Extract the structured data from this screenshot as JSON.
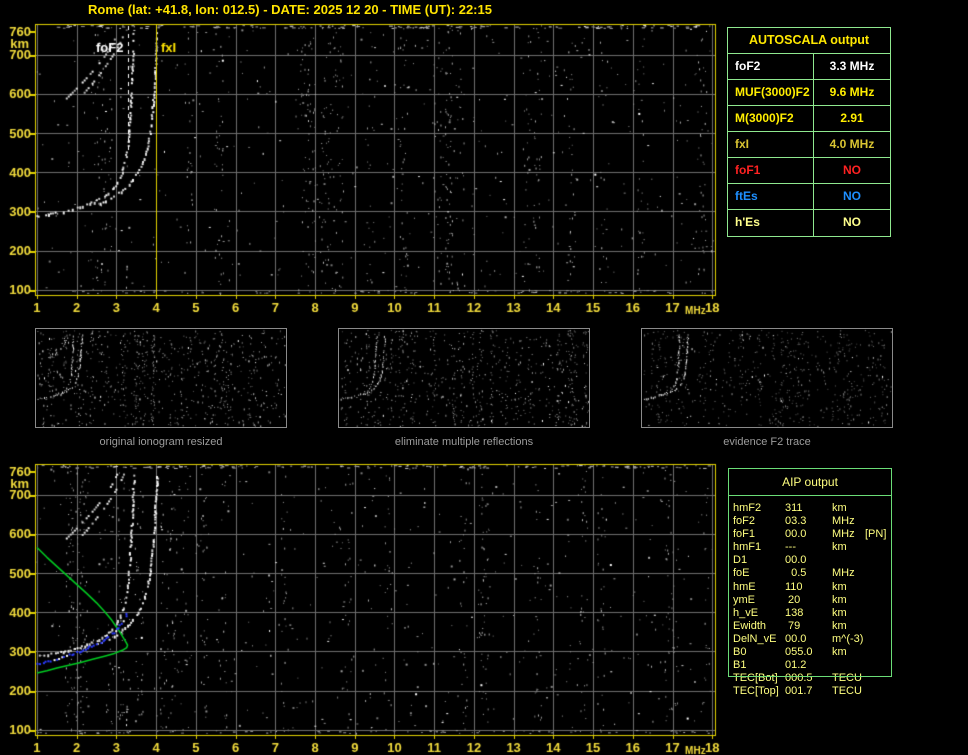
{
  "title": "Rome (lat: +41.8, lon: 012.5) - DATE: 2025 12 20 - TIME (UT): 22:15",
  "colors": {
    "background": "#000000",
    "plot_border": "#E3D300",
    "grid": "#6F6F6F",
    "axis_text": "#F2DC3C",
    "autoscala_border": "#8FE88F",
    "aip_border": "#6ADD77",
    "aip_text": "#FFFF80",
    "caption_text": "#9C9C9C",
    "trace_white": "#FFFFFF",
    "profile_green": "#00CE22",
    "fitted_blue": "#2B3BFF"
  },
  "autoscala": {
    "header": "AUTOSCALA output",
    "rows": [
      {
        "label": "foF2",
        "value": "3.3 MHz",
        "color": "#FFFFFF"
      },
      {
        "label": "MUF(3000)F2",
        "value": "9.6 MHz",
        "color": "#FFEE00"
      },
      {
        "label": "M(3000)F2",
        "value": "2.91",
        "color": "#FFEE00"
      },
      {
        "label": "fxI",
        "value": "4.0 MHz",
        "color": "#D9C432"
      },
      {
        "label": "foF1",
        "value": "NO",
        "color": "#FF2222"
      },
      {
        "label": "ftEs",
        "value": "NO",
        "color": "#1E8FFF"
      },
      {
        "label": "h'Es",
        "value": "NO",
        "color": "#FFFF8C"
      }
    ]
  },
  "aip": {
    "header": "AIP output",
    "rows": [
      {
        "label": "hmF2",
        "value": "311",
        "unit": "km",
        "extra": ""
      },
      {
        "label": "foF2",
        "value": "03.3",
        "unit": "MHz",
        "extra": ""
      },
      {
        "label": "foF1",
        "value": "00.0",
        "unit": "MHz",
        "extra": "[PN]"
      },
      {
        "label": "hmF1",
        "value": "---",
        "unit": "km",
        "extra": ""
      },
      {
        "label": "D1",
        "value": "00.0",
        "unit": "",
        "extra": ""
      },
      {
        "label": "foE",
        "value": "  0.5",
        "unit": "MHz",
        "extra": ""
      },
      {
        "label": "hmE",
        "value": "110",
        "unit": "km",
        "extra": ""
      },
      {
        "label": "ymE",
        "value": " 20",
        "unit": "km",
        "extra": ""
      },
      {
        "label": "h_vE",
        "value": "138",
        "unit": "km",
        "extra": ""
      },
      {
        "label": "Ewidth",
        "value": " 79",
        "unit": "km",
        "extra": ""
      },
      {
        "label": "DelN_vE",
        "value": "00.0",
        "unit": "m^(-3)",
        "extra": ""
      },
      {
        "label": "B0",
        "value": "055.0",
        "unit": "km",
        "extra": ""
      },
      {
        "label": "B1",
        "value": "01.2",
        "unit": "",
        "extra": ""
      },
      {
        "label": "TEC[Bot]",
        "value": "000.5",
        "unit": "TECU",
        "extra": ""
      },
      {
        "label": "TEC[Top]",
        "value": "001.7",
        "unit": "TECU",
        "extra": ""
      }
    ]
  },
  "thumbnails": [
    {
      "caption": "original ionogram resized"
    },
    {
      "caption": "eliminate multiple reflections"
    },
    {
      "caption": "evidence F2 trace"
    }
  ],
  "ionogram_labels": {
    "foF2": "foF2",
    "fxI": "fxI"
  },
  "axes": {
    "x_ticks": [
      1,
      2,
      3,
      4,
      5,
      6,
      7,
      8,
      9,
      10,
      11,
      12,
      13,
      14,
      15,
      16,
      17,
      18
    ],
    "x_unit": "MHz",
    "y_ticks": [
      760,
      700,
      600,
      500,
      400,
      300,
      200,
      100
    ],
    "y_unit": "km"
  },
  "chart_data": {
    "type": "scatter",
    "title": "ionogram (virtual height vs frequency)",
    "xlabel": "MHz",
    "ylabel": "km",
    "x_range": [
      1,
      18
    ],
    "y_range": [
      100,
      760
    ],
    "markers": {
      "foF2_MHz": 3.3,
      "fxI_MHz": 4.0
    },
    "series": [
      {
        "name": "F2-trace-O-mode",
        "color": "#FFFFFF",
        "style": "beads",
        "plots": "both",
        "points": [
          [
            1.0,
            287
          ],
          [
            1.3,
            292
          ],
          [
            1.6,
            298
          ],
          [
            1.9,
            305
          ],
          [
            2.2,
            314
          ],
          [
            2.45,
            324
          ],
          [
            2.65,
            334
          ],
          [
            2.82,
            346
          ],
          [
            2.95,
            360
          ],
          [
            3.06,
            377
          ],
          [
            3.15,
            398
          ],
          [
            3.22,
            424
          ],
          [
            3.28,
            456
          ],
          [
            3.32,
            495
          ],
          [
            3.35,
            540
          ],
          [
            3.38,
            590
          ],
          [
            3.41,
            645
          ],
          [
            3.43,
            700
          ],
          [
            3.45,
            760
          ]
        ]
      },
      {
        "name": "F2-trace-X-mode",
        "color": "#FFFFFF",
        "style": "beads",
        "plots": "both",
        "points": [
          [
            2.55,
            318
          ],
          [
            2.75,
            327
          ],
          [
            2.95,
            338
          ],
          [
            3.12,
            350
          ],
          [
            3.28,
            364
          ],
          [
            3.42,
            380
          ],
          [
            3.55,
            399
          ],
          [
            3.66,
            421
          ],
          [
            3.75,
            448
          ],
          [
            3.82,
            480
          ],
          [
            3.88,
            518
          ],
          [
            3.92,
            560
          ],
          [
            3.96,
            610
          ],
          [
            3.99,
            665
          ],
          [
            4.02,
            720
          ],
          [
            4.04,
            760
          ]
        ]
      },
      {
        "name": "multiple-reflection-1",
        "color": "#FFFFFF",
        "style": "dash",
        "plots": "both",
        "points": [
          [
            1.7,
            583
          ],
          [
            1.95,
            608
          ],
          [
            2.2,
            634
          ],
          [
            2.45,
            662
          ],
          [
            2.7,
            694
          ],
          [
            2.9,
            726
          ],
          [
            3.05,
            757
          ]
        ]
      },
      {
        "name": "multiple-reflection-2",
        "color": "#FFFFFF",
        "style": "dash",
        "plots": "both",
        "points": [
          [
            2.15,
            597
          ],
          [
            2.4,
            626
          ],
          [
            2.65,
            658
          ],
          [
            2.9,
            695
          ],
          [
            3.1,
            730
          ],
          [
            3.22,
            758
          ]
        ]
      },
      {
        "name": "low-height-echo",
        "color": "#FFFFFF",
        "style": "sparse",
        "plots": "both",
        "points": [
          [
            3.24,
            108
          ],
          [
            3.26,
            175
          ]
        ]
      },
      {
        "name": "electron-density-profile",
        "color": "#00CE22",
        "style": "line",
        "plots": "bottom",
        "points": [
          [
            1.0,
            565
          ],
          [
            1.25,
            540
          ],
          [
            1.5,
            517
          ],
          [
            1.75,
            494
          ],
          [
            2.0,
            471
          ],
          [
            2.25,
            448
          ],
          [
            2.5,
            424
          ],
          [
            2.7,
            402
          ],
          [
            2.88,
            380
          ],
          [
            3.03,
            358
          ],
          [
            3.15,
            339
          ],
          [
            3.24,
            324
          ],
          [
            3.28,
            316
          ],
          [
            3.26,
            310
          ],
          [
            3.15,
            303
          ],
          [
            2.95,
            295
          ],
          [
            2.7,
            288
          ],
          [
            2.4,
            280
          ],
          [
            2.1,
            272
          ],
          [
            1.8,
            265
          ],
          [
            1.5,
            258
          ],
          [
            1.25,
            251
          ],
          [
            1.0,
            245
          ]
        ]
      },
      {
        "name": "autoscala-fitted-trace",
        "color": "#2B3BFF",
        "style": "bluedots",
        "plots": "bottom",
        "points": [
          [
            1.0,
            271
          ],
          [
            1.2,
            276
          ],
          [
            1.4,
            281
          ],
          [
            1.6,
            287
          ],
          [
            1.8,
            293
          ],
          [
            2.0,
            300
          ],
          [
            2.2,
            308
          ],
          [
            2.4,
            317
          ],
          [
            2.58,
            326
          ],
          [
            2.74,
            336
          ],
          [
            2.88,
            347
          ],
          [
            3.0,
            359
          ],
          [
            3.1,
            372
          ],
          [
            3.18,
            385
          ],
          [
            3.25,
            397
          ],
          [
            3.3,
            407
          ]
        ]
      }
    ]
  }
}
